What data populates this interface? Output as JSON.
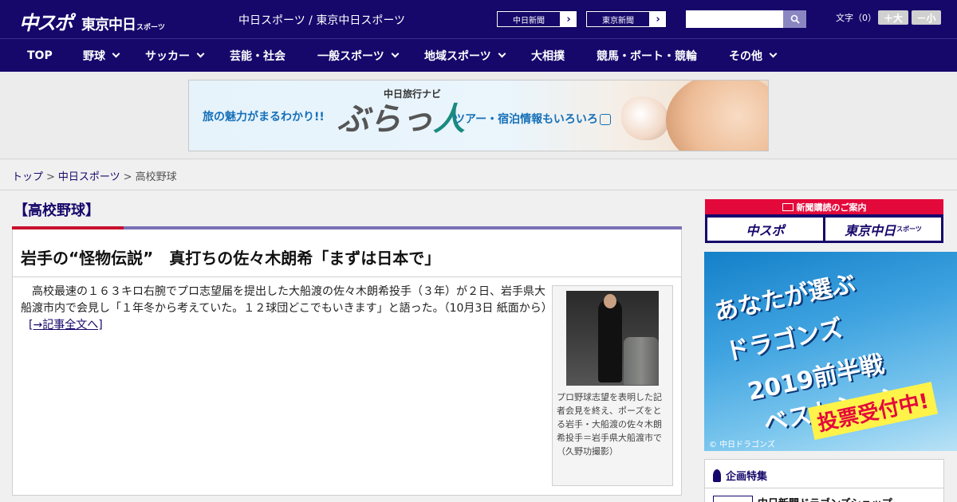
{
  "header": {
    "logo_chuspo": "中スポ",
    "logo_tokyo": "東京中日",
    "logo_tokyo_sub": "スポーツ",
    "site_name": "中日スポーツ / 東京中日スポーツ",
    "paper_links": [
      "中日新聞",
      "東京新聞"
    ],
    "font_size_label": "文字（0）",
    "font_larger": "＋大",
    "font_smaller": "－小"
  },
  "nav": {
    "items": [
      {
        "label": "TOP"
      },
      {
        "label": "野球"
      },
      {
        "label": "サッカー"
      },
      {
        "label": "芸能・社会"
      },
      {
        "label": "一般スポーツ"
      },
      {
        "label": "地域スポーツ"
      },
      {
        "label": "大相撲"
      },
      {
        "label": "競馬・ボート・競輪"
      },
      {
        "label": "その他"
      }
    ]
  },
  "ad": {
    "left_text": "旅の魅力がまるわかり!!",
    "navi_label": "中日旅行ナビ",
    "brand_a": "ぶらっ",
    "brand_b": "人",
    "right_text": "ツアー・宿泊情報もいろいろ"
  },
  "breadcrumb": {
    "items": [
      "トップ",
      "中日スポーツ"
    ],
    "current": "高校野球",
    "separator": ">"
  },
  "article": {
    "section": "【高校野球】",
    "headline": "岩手の“怪物伝説”　真打ちの佐々木朗希「まずは日本で」",
    "body": "高校最速の１６３キロ右腕でプロ志望届を提出した大船渡の佐々木朗希投手（３年）が２日、岩手県大船渡市内で会見し「１年冬から考えていた。１２球団どこでもいきます」と語った。（10月3日 紙面から）",
    "more_link": "[→記事全文へ]",
    "photo_caption": "プロ野球志望を表明した記者会見を終え、ポーズをとる岩手・大船渡の佐々木朗希投手＝岩手県大船渡市で（久野功撮影）"
  },
  "sidebar": {
    "subscribe_heading": "新聞購読のご案内",
    "subscribe_chuspo": "中スポ",
    "subscribe_tokyo": "東京中日",
    "subscribe_tokyo_sub": "スポーツ",
    "poll_lines": [
      "あなたが選ぶ",
      "ドラゴンズ",
      "2019前半戦",
      "ベストシーン"
    ],
    "poll_badge": "投票受付中!",
    "poll_copyright": "© 中日ドラゴンズ",
    "feature_title": "企画特集",
    "feature_item": "中日新聞ドラゴンズショップ"
  },
  "colors": {
    "brand_navy": "#16076b",
    "accent_red": "#c8102e",
    "subscribe_red": "#e4093b"
  }
}
